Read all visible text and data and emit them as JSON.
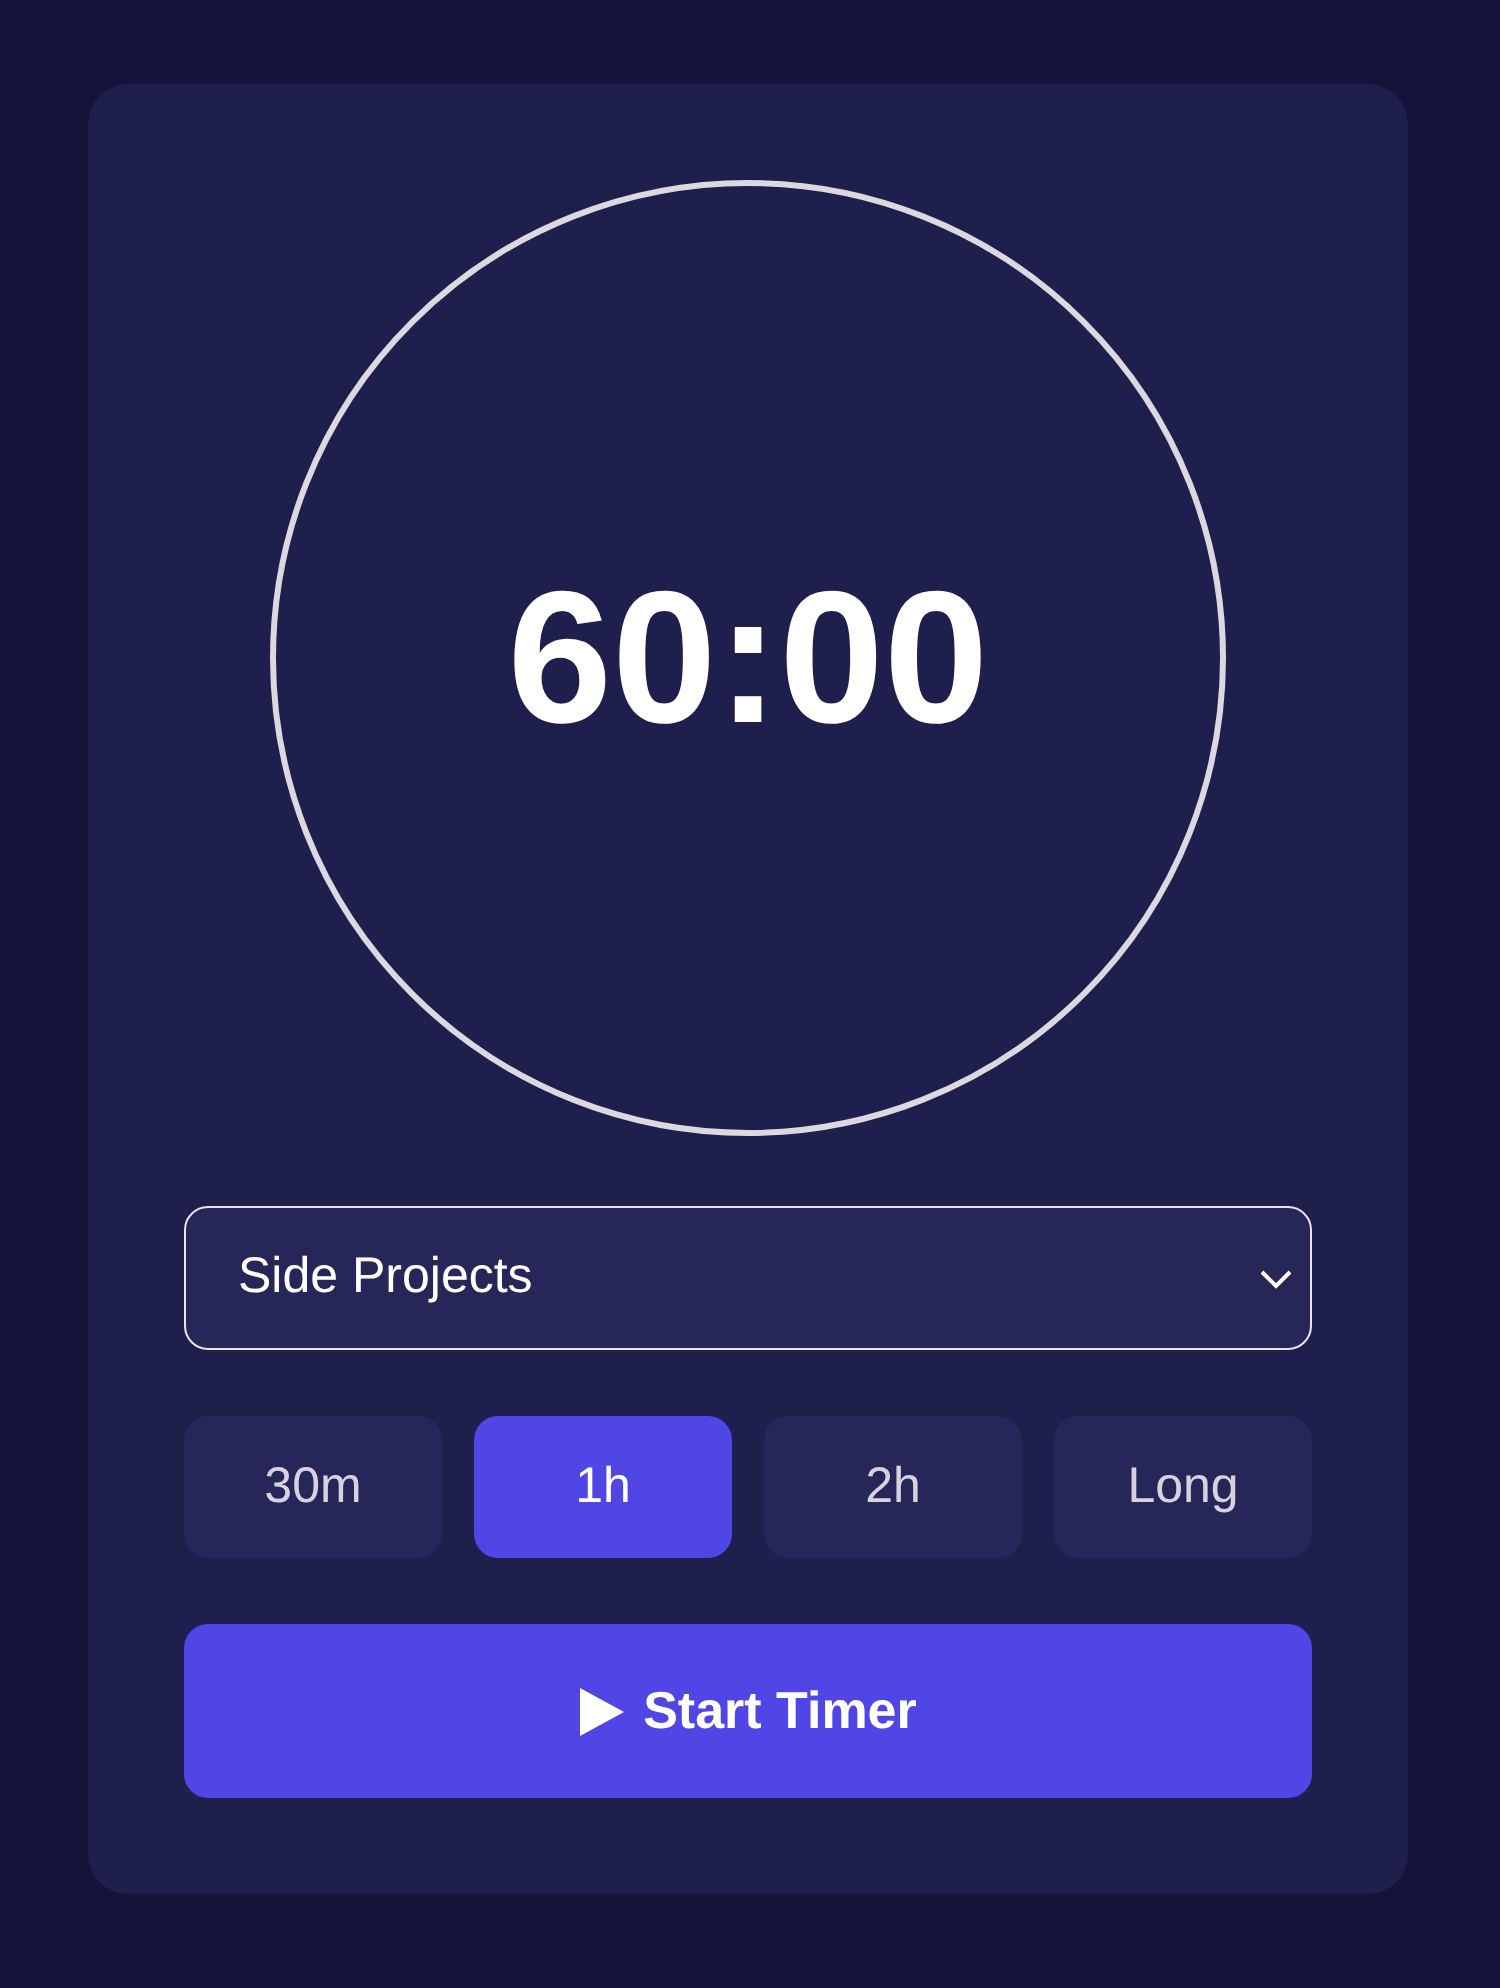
{
  "timer": {
    "display": "60:00"
  },
  "category_select": {
    "value": "Side Projects"
  },
  "durations": [
    {
      "label": "30m",
      "selected": false
    },
    {
      "label": "1h",
      "selected": true
    },
    {
      "label": "2h",
      "selected": false
    },
    {
      "label": "Long",
      "selected": false
    }
  ],
  "start_button": {
    "label": "Start Timer"
  }
}
